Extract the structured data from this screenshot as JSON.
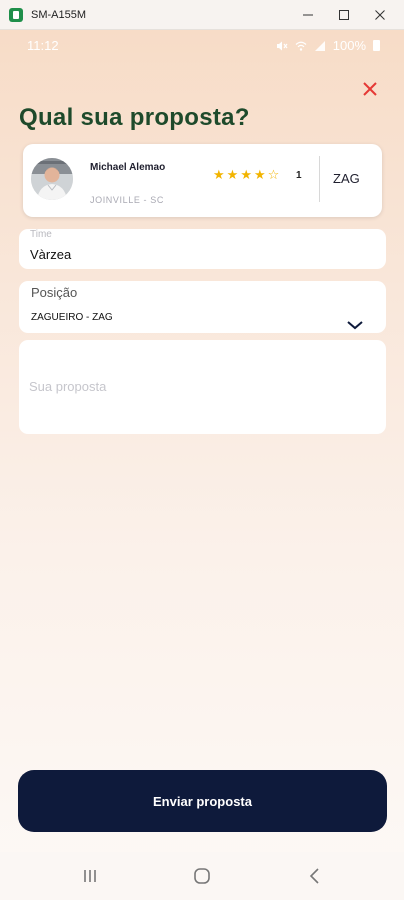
{
  "window": {
    "title": "SM-A155M",
    "icon": "android-phone-icon",
    "controls": [
      "minimize-icon",
      "maximize-icon",
      "close-icon"
    ]
  },
  "status_bar": {
    "time": "11:12",
    "icons": [
      "mute-icon",
      "wifi-icon",
      "signal-icon"
    ],
    "battery": "100%"
  },
  "page": {
    "title": "Qual sua proposta?",
    "close_icon": "close-x-icon"
  },
  "player": {
    "name": "Michael Alemao",
    "location": "JOINVILLE - SC",
    "rating": 4,
    "rating_max": 5,
    "rating_count": "1",
    "position": "ZAG"
  },
  "form": {
    "time": {
      "label": "Time",
      "value": "Vàrzea"
    },
    "position": {
      "label": "Posição",
      "value": "ZAGUEIRO - ZAG"
    },
    "proposal": {
      "placeholder": "Sua proposta",
      "value": ""
    }
  },
  "submit": {
    "label": "Enviar proposta"
  },
  "nav": [
    "recents-icon",
    "home-icon",
    "back-icon"
  ],
  "colors": {
    "title_green": "#1e4a2b",
    "button_navy": "#0e1a3b",
    "star_gold": "#f2b400",
    "close_red": "#e53935"
  }
}
